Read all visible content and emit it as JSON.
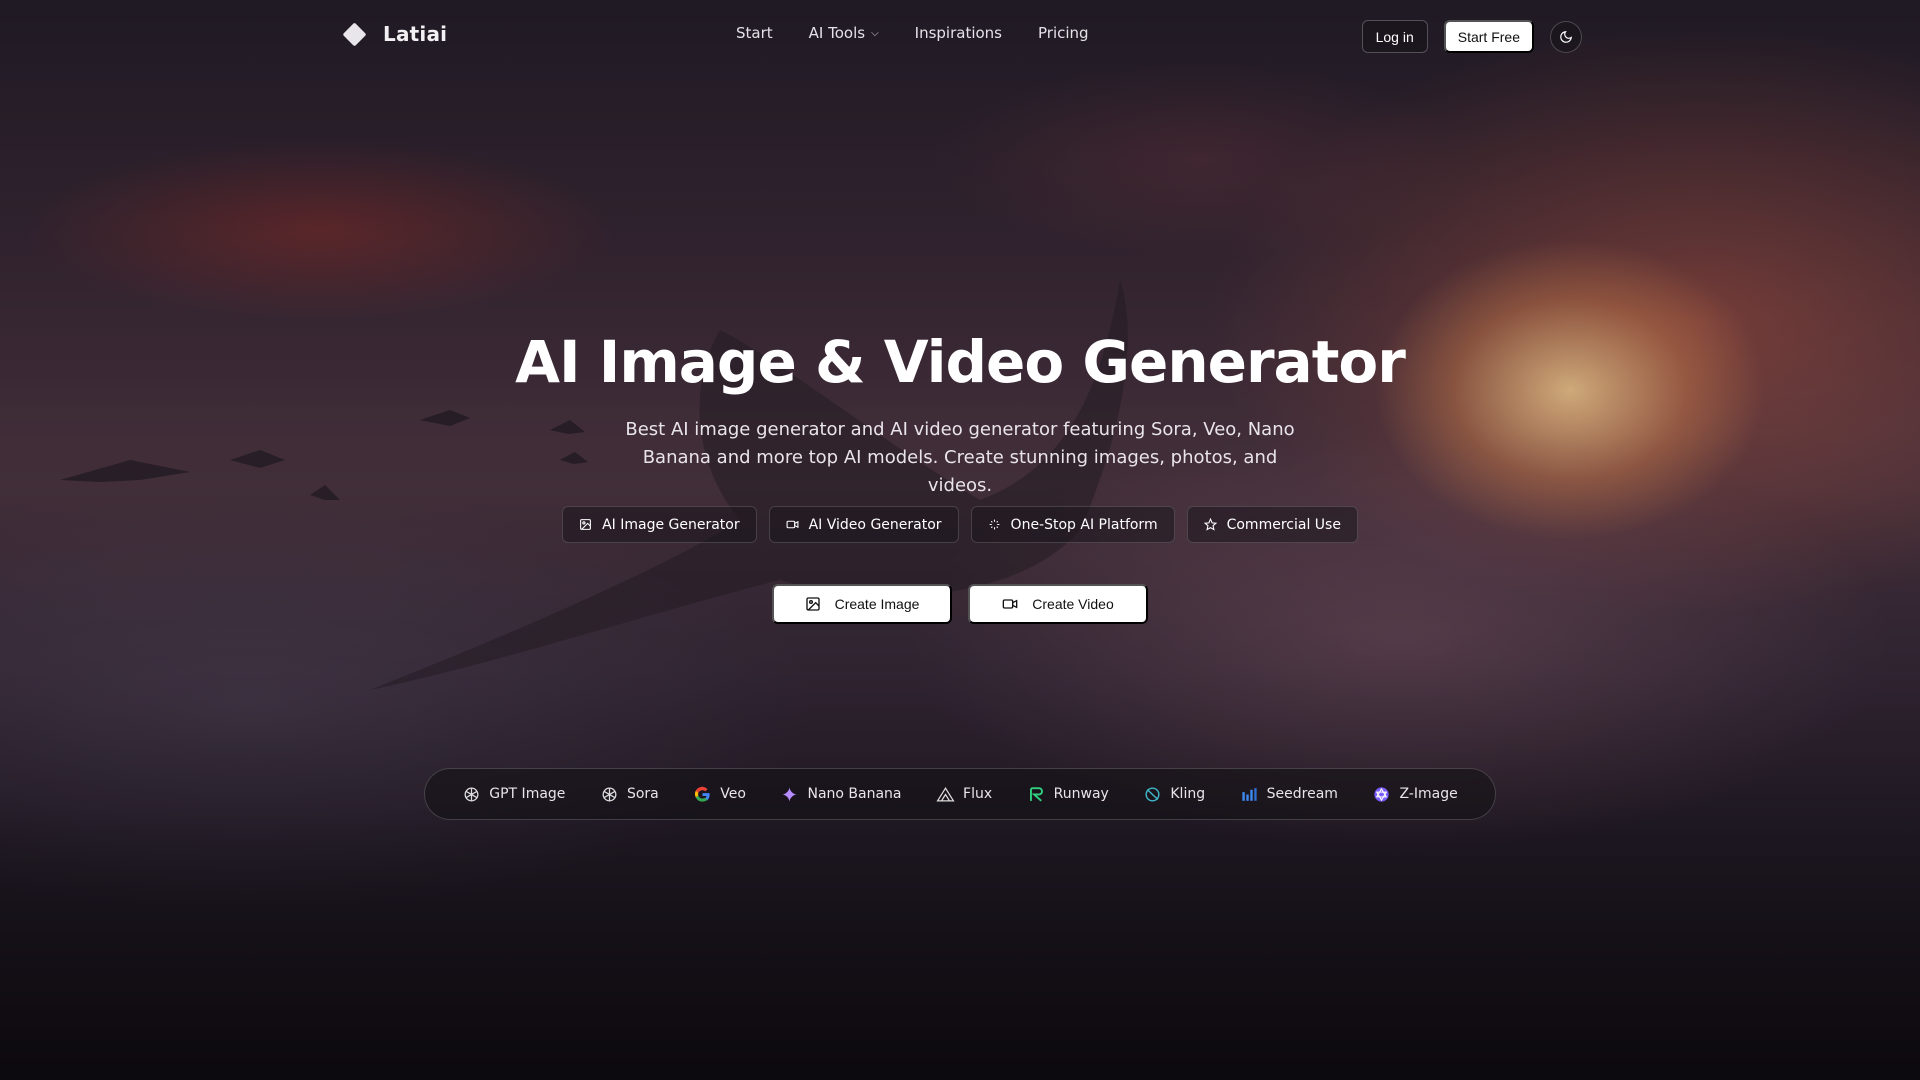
{
  "header": {
    "brand_name": "Latiai",
    "nav": [
      {
        "label": "Start",
        "icon": null
      },
      {
        "label": "AI Tools",
        "icon": "chevron-down-icon"
      },
      {
        "label": "Inspirations",
        "icon": null
      },
      {
        "label": "Pricing",
        "icon": null
      }
    ],
    "login_label": "Log in",
    "start_free_label": "Start Free",
    "theme_icon": "moon-icon"
  },
  "hero": {
    "title": "AI Image & Video Generator",
    "subtitle": "Best AI image generator and AI video generator featuring Sora, Veo, Nano Banana and more top AI models. Create stunning images, photos, and videos.",
    "chips": [
      {
        "label": "AI Image Generator",
        "icon": "image-icon"
      },
      {
        "label": "AI Video Generator",
        "icon": "video-icon"
      },
      {
        "label": "One-Stop AI Platform",
        "icon": "sparkles-icon"
      },
      {
        "label": "Commercial Use",
        "icon": "star-icon"
      }
    ],
    "cta": {
      "create_image": "Create Image",
      "create_video": "Create Video"
    }
  },
  "models": [
    {
      "label": "GPT Image",
      "icon": "openai-icon"
    },
    {
      "label": "Sora",
      "icon": "openai-icon"
    },
    {
      "label": "Veo",
      "icon": "google-icon"
    },
    {
      "label": "Nano Banana",
      "icon": "sparkle-icon"
    },
    {
      "label": "Flux",
      "icon": "flux-icon"
    },
    {
      "label": "Runway",
      "icon": "runway-icon"
    },
    {
      "label": "Kling",
      "icon": "kling-icon"
    },
    {
      "label": "Seedream",
      "icon": "seedream-icon"
    },
    {
      "label": "Z-Image",
      "icon": "z-image-icon"
    }
  ],
  "colors": {
    "cta_background": "#ffffff",
    "google_blue": "#4285F4",
    "runway_green": "#2fd17f",
    "kling_teal": "#3fb7c9",
    "seedream_blue": "#3d8bf2",
    "zimage_purple": "#7b5cff"
  }
}
